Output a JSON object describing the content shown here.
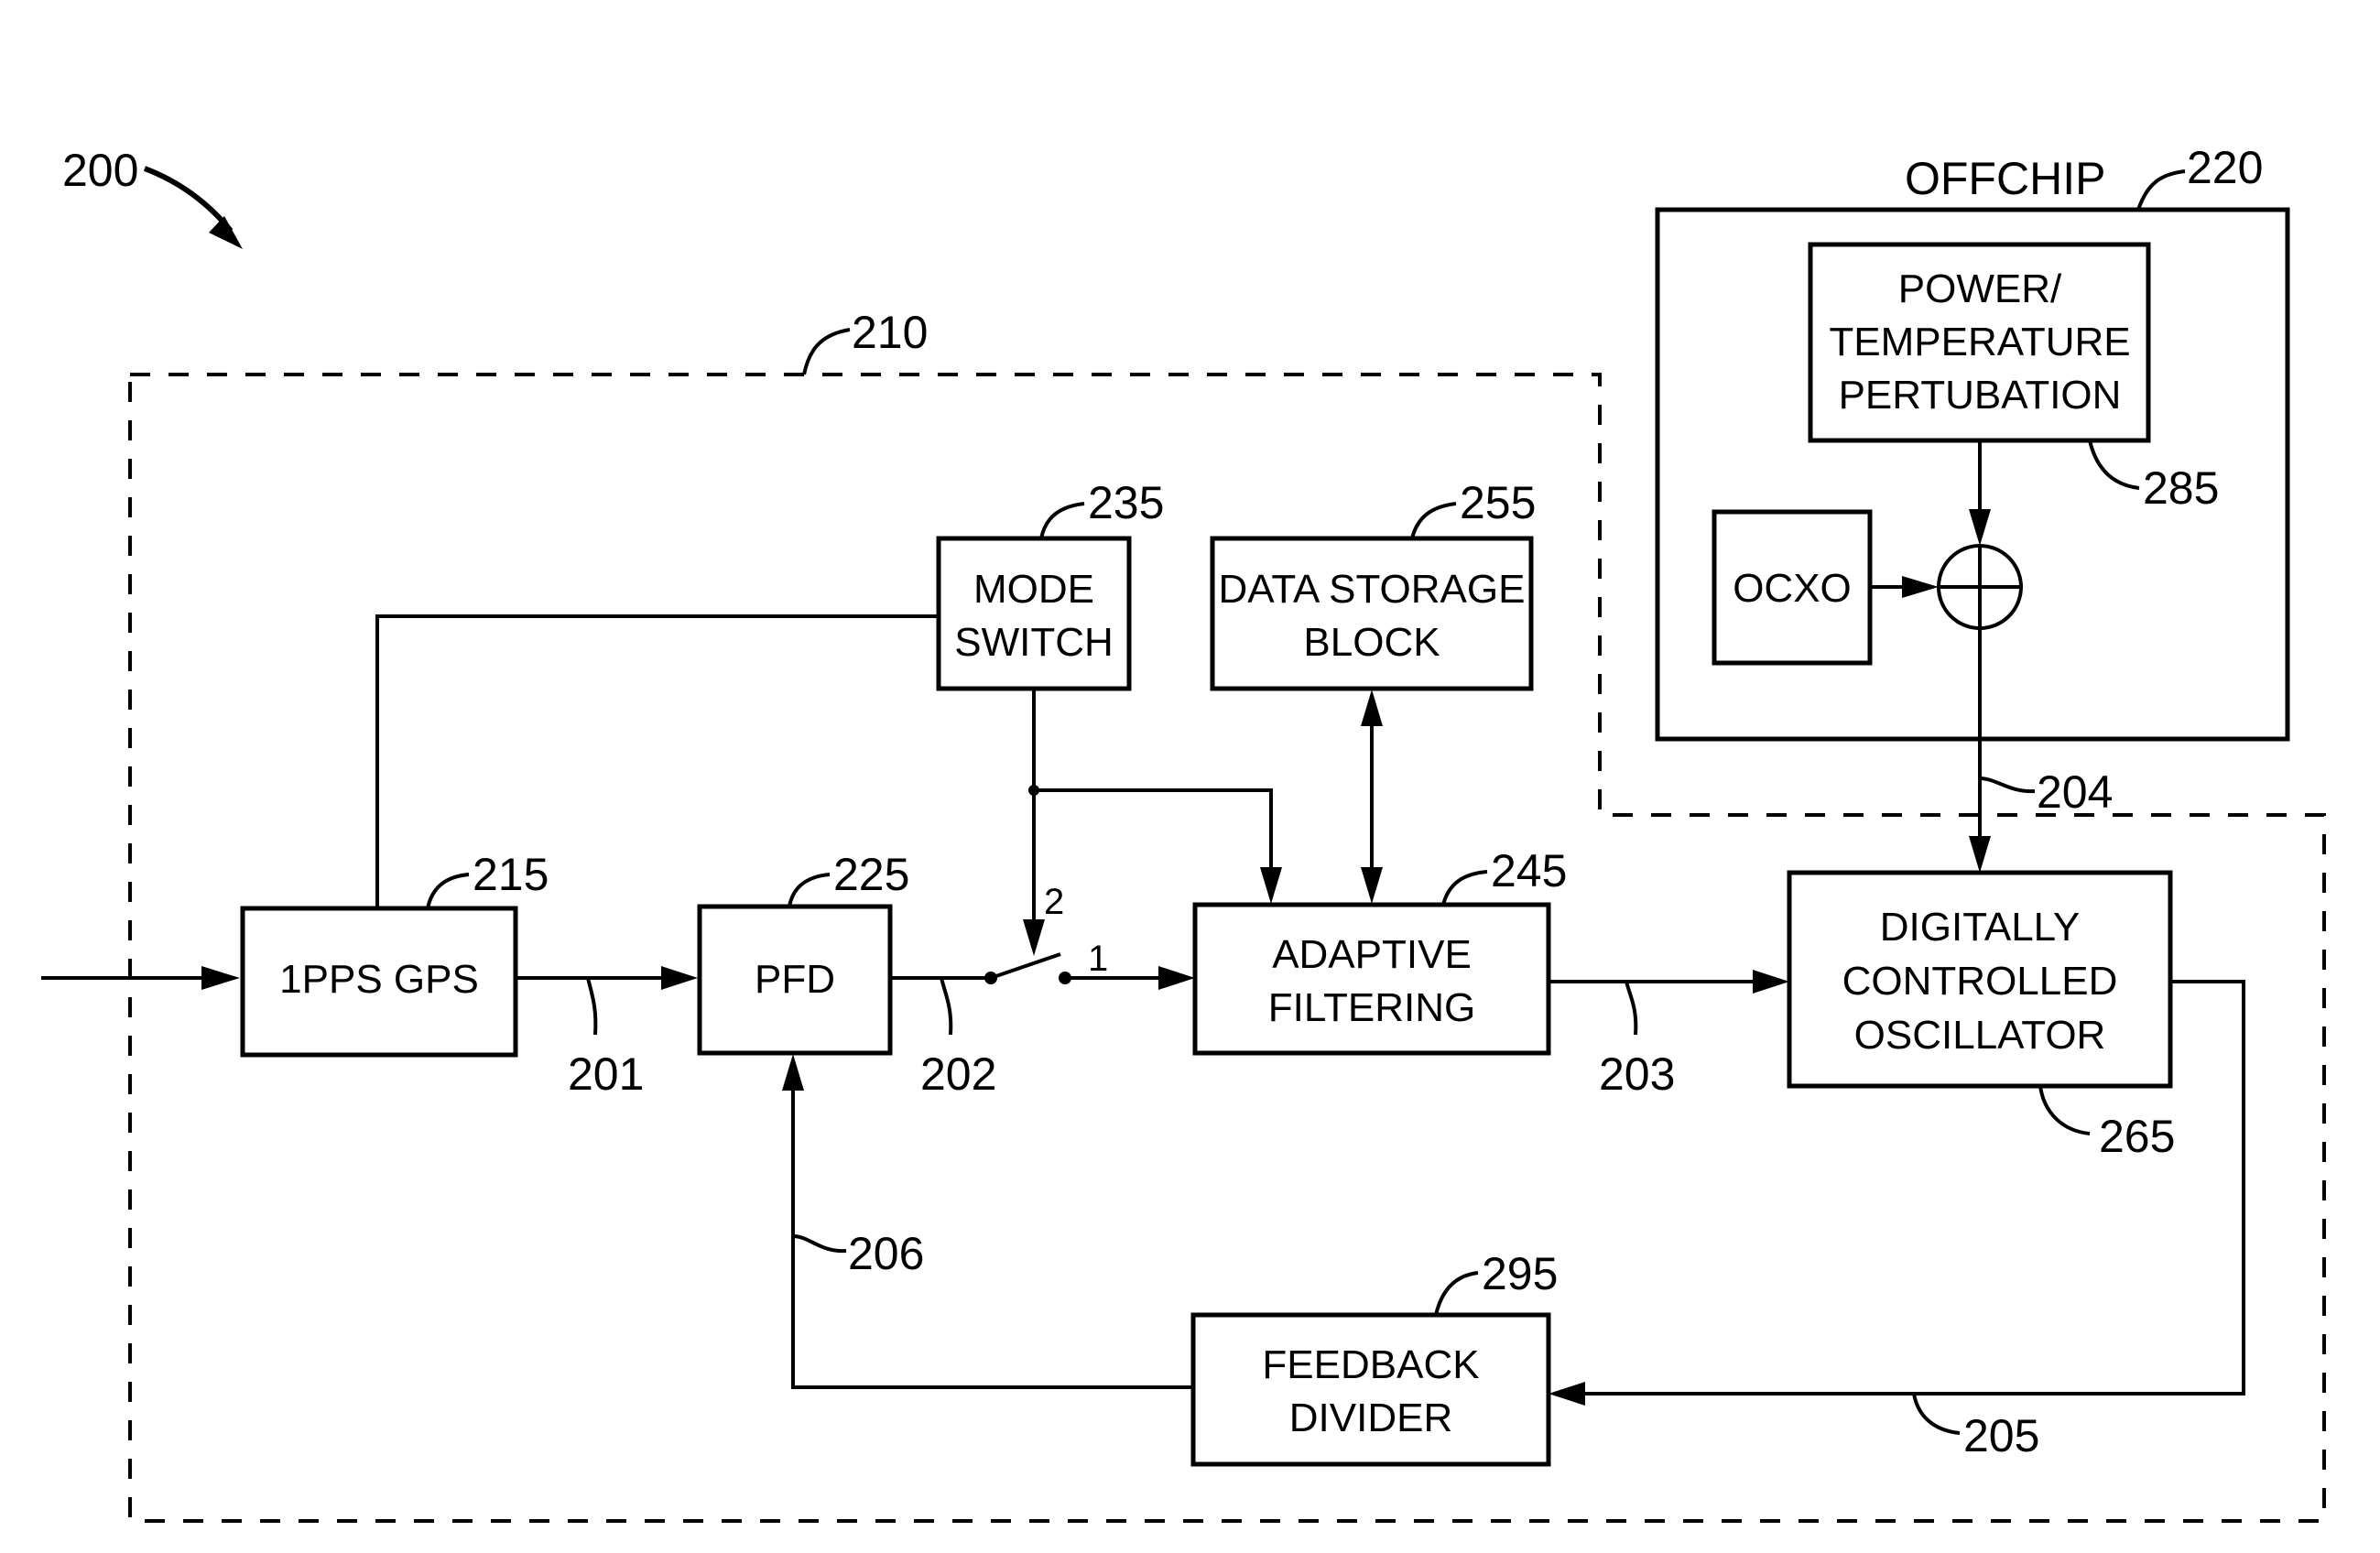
{
  "figure": {
    "ref": "200"
  },
  "regions": {
    "onchip": {
      "ref": "210"
    },
    "offchip": {
      "ref": "220",
      "title": "OFFCHIP"
    }
  },
  "blocks": {
    "gps": {
      "ref": "215",
      "lines": [
        "1PPS GPS"
      ]
    },
    "pfd": {
      "ref": "225",
      "lines": [
        "PFD"
      ]
    },
    "mode_switch": {
      "ref": "235",
      "lines": [
        "MODE",
        "SWITCH"
      ]
    },
    "data_storage": {
      "ref": "255",
      "lines": [
        "DATA STORAGE",
        "BLOCK"
      ]
    },
    "adaptive_filtering": {
      "ref": "245",
      "lines": [
        "ADAPTIVE",
        "FILTERING"
      ]
    },
    "dco": {
      "ref": "265",
      "lines": [
        "DIGITALLY",
        "CONTROLLED",
        "OSCILLATOR"
      ]
    },
    "feedback_divider": {
      "ref": "295",
      "lines": [
        "FEEDBACK",
        "DIVIDER"
      ]
    },
    "power_temp": {
      "ref": "285",
      "lines": [
        "POWER/",
        "TEMPERATURE",
        "PERTUBATION"
      ]
    },
    "ocxo": {
      "lines": [
        "OCXO"
      ]
    }
  },
  "signals": {
    "s201": "201",
    "s202": "202",
    "s203": "203",
    "s204": "204",
    "s205": "205",
    "s206": "206"
  },
  "switch": {
    "pos1": "1",
    "pos2": "2"
  }
}
